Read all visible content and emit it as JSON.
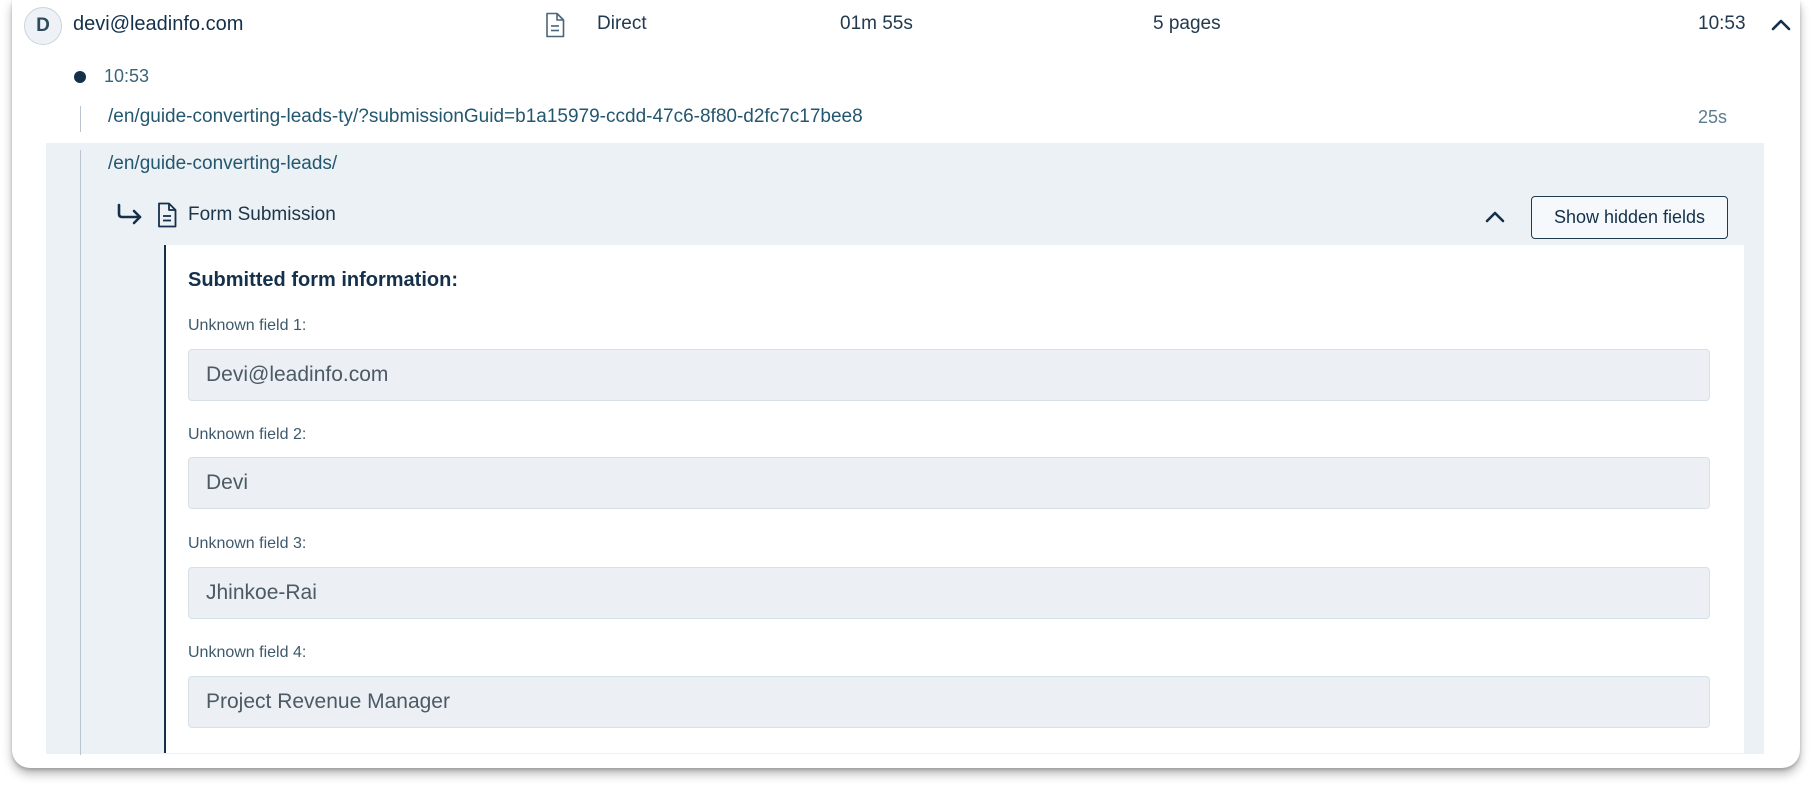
{
  "session": {
    "avatar_initial": "D",
    "email": "devi@leadinfo.com",
    "source": "Direct",
    "duration": "01m 55s",
    "pages": "5 pages",
    "time": "10:53",
    "source_icon": "document-icon",
    "collapse_icon": "chevron-up-icon"
  },
  "visit": {
    "time": "10:53"
  },
  "pageviews": [
    {
      "url": "/en/guide-converting-leads-ty/?submissionGuid=b1a15979-ccdd-47c6-8f80-d2fc7c17bee8",
      "duration": "25s"
    },
    {
      "url": "/en/guide-converting-leads/",
      "duration": ""
    }
  ],
  "form_submission": {
    "title": "Form Submission",
    "arrow_icon": "arrow-return-right-icon",
    "doc_icon": "document-icon",
    "collapse_icon": "chevron-up-icon",
    "show_hidden_label": "Show hidden fields",
    "heading": "Submitted form information:",
    "fields": [
      {
        "label": "Unknown field 1:",
        "value": "Devi@leadinfo.com"
      },
      {
        "label": "Unknown field 2:",
        "value": "Devi"
      },
      {
        "label": "Unknown field 3:",
        "value": "Jhinkoe-Rai"
      },
      {
        "label": "Unknown field 4:",
        "value": "Project Revenue Manager"
      }
    ]
  }
}
